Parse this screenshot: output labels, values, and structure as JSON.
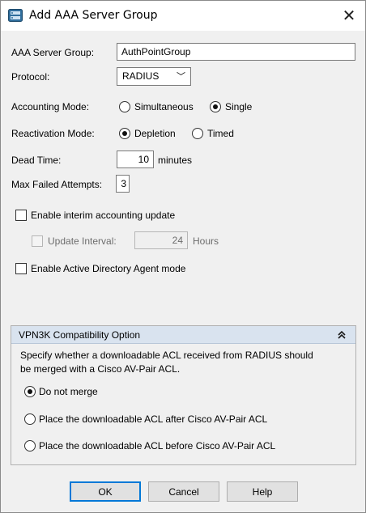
{
  "window": {
    "title": "Add AAA Server Group",
    "close_glyph": "✕",
    "icon": "aaa-server-group-icon"
  },
  "form": {
    "server_group": {
      "label": "AAA Server Group:",
      "value": "AuthPointGroup"
    },
    "protocol": {
      "label": "Protocol:",
      "value": "RADIUS",
      "chevron": "﹀"
    },
    "accounting_mode": {
      "label": "Accounting Mode:",
      "options": [
        "Simultaneous",
        "Single"
      ],
      "selected": "Single"
    },
    "reactivation_mode": {
      "label": "Reactivation Mode:",
      "options": [
        "Depletion",
        "Timed"
      ],
      "selected": "Depletion"
    },
    "dead_time": {
      "label": "Dead Time:",
      "value": "10",
      "unit": "minutes"
    },
    "max_failed": {
      "label": "Max Failed Attempts:",
      "value": "3"
    },
    "interim_update": {
      "label": "Enable interim accounting update",
      "checked": false
    },
    "update_interval": {
      "label": "Update Interval:",
      "value": "24",
      "unit": "Hours",
      "disabled": true
    },
    "ad_agent": {
      "label": "Enable Active Directory Agent mode",
      "checked": false
    }
  },
  "vpn3k": {
    "title": "VPN3K Compatibility Option",
    "collapse_icon": "collapse-up-icon",
    "description_line1": "Specify whether a downloadable ACL received from RADIUS should",
    "description_line2": "be merged with a Cisco AV-Pair ACL.",
    "options": [
      "Do not merge",
      "Place the downloadable ACL after Cisco AV-Pair ACL",
      "Place the downloadable ACL before Cisco AV-Pair ACL"
    ],
    "selected": "Do not merge"
  },
  "buttons": {
    "ok": "OK",
    "cancel": "Cancel",
    "help": "Help"
  },
  "colors": {
    "dialog_bg": "#f0f0f0",
    "panel_header": "#d9e3ef",
    "default_button_border": "#0078d7"
  }
}
